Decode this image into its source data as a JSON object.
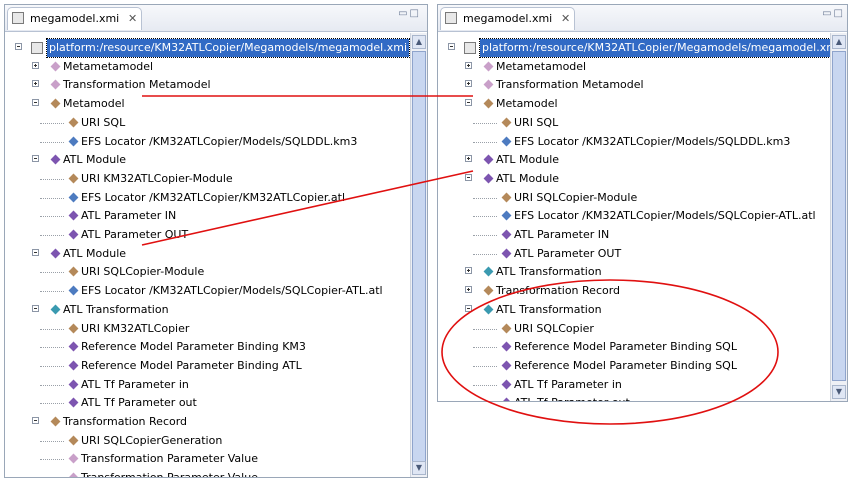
{
  "left": {
    "tab_title": "megamodel.xmi",
    "close_glyph": "✕",
    "rows": [
      {
        "t": "platform:/resource/KM32ATLCopier/Megamodels/megamodel.xmi",
        "lvl": 0,
        "exp": "minus",
        "icon": "xmi",
        "sel": true
      },
      {
        "t": "Metametamodel",
        "lvl": 1,
        "exp": "plus",
        "icon": "light"
      },
      {
        "t": "Transformation Metamodel",
        "lvl": 1,
        "exp": "plus",
        "icon": "light"
      },
      {
        "t": "Metamodel",
        "lvl": 1,
        "exp": "minus",
        "icon": "tan"
      },
      {
        "t": "URI SQL",
        "lvl": 2,
        "icon": "tan"
      },
      {
        "t": "EFS Locator /KM32ATLCopier/Models/SQLDDL.km3",
        "lvl": 2,
        "icon": "blue"
      },
      {
        "t": "ATL Module",
        "lvl": 1,
        "exp": "minus",
        "icon": "purple"
      },
      {
        "t": "URI KM32ATLCopier-Module",
        "lvl": 2,
        "icon": "tan"
      },
      {
        "t": "EFS Locator /KM32ATLCopier/KM32ATLCopier.atl",
        "lvl": 2,
        "icon": "blue"
      },
      {
        "t": "ATL Parameter IN",
        "lvl": 2,
        "icon": "purple"
      },
      {
        "t": "ATL Parameter OUT",
        "lvl": 2,
        "icon": "purple"
      },
      {
        "t": "ATL Module",
        "lvl": 1,
        "exp": "minus",
        "icon": "purple"
      },
      {
        "t": "URI SQLCopier-Module",
        "lvl": 2,
        "icon": "tan"
      },
      {
        "t": "EFS Locator /KM32ATLCopier/Models/SQLCopier-ATL.atl",
        "lvl": 2,
        "icon": "blue"
      },
      {
        "t": "ATL Transformation",
        "lvl": 1,
        "exp": "minus",
        "icon": "teal"
      },
      {
        "t": "URI KM32ATLCopier",
        "lvl": 2,
        "icon": "tan"
      },
      {
        "t": "Reference Model Parameter Binding KM3",
        "lvl": 2,
        "icon": "purple"
      },
      {
        "t": "Reference Model Parameter Binding ATL",
        "lvl": 2,
        "icon": "purple"
      },
      {
        "t": "ATL Tf Parameter in",
        "lvl": 2,
        "icon": "purple"
      },
      {
        "t": "ATL Tf Parameter out",
        "lvl": 2,
        "icon": "purple"
      },
      {
        "t": "Transformation Record",
        "lvl": 1,
        "exp": "minus",
        "icon": "tan"
      },
      {
        "t": "URI SQLCopierGeneration",
        "lvl": 2,
        "icon": "tan"
      },
      {
        "t": "Transformation Parameter Value",
        "lvl": 2,
        "icon": "light"
      },
      {
        "t": "Transformation Parameter Value",
        "lvl": 2,
        "icon": "light"
      }
    ]
  },
  "right": {
    "tab_title": "megamodel.xmi",
    "close_glyph": "✕",
    "rows": [
      {
        "t": "platform:/resource/KM32ATLCopier/Megamodels/megamodel.xmi",
        "lvl": 0,
        "exp": "minus",
        "icon": "xmi",
        "sel": true
      },
      {
        "t": "Metametamodel",
        "lvl": 1,
        "exp": "plus",
        "icon": "light"
      },
      {
        "t": "Transformation Metamodel",
        "lvl": 1,
        "exp": "plus",
        "icon": "light"
      },
      {
        "t": "Metamodel",
        "lvl": 1,
        "exp": "minus",
        "icon": "tan"
      },
      {
        "t": "URI SQL",
        "lvl": 2,
        "icon": "tan"
      },
      {
        "t": "EFS Locator /KM32ATLCopier/Models/SQLDDL.km3",
        "lvl": 2,
        "icon": "blue"
      },
      {
        "t": "ATL Module",
        "lvl": 1,
        "exp": "plus",
        "icon": "purple"
      },
      {
        "t": "ATL Module",
        "lvl": 1,
        "exp": "minus",
        "icon": "purple"
      },
      {
        "t": "URI SQLCopier-Module",
        "lvl": 2,
        "icon": "tan"
      },
      {
        "t": "EFS Locator /KM32ATLCopier/Models/SQLCopier-ATL.atl",
        "lvl": 2,
        "icon": "blue"
      },
      {
        "t": "ATL Parameter IN",
        "lvl": 2,
        "icon": "purple"
      },
      {
        "t": "ATL Parameter OUT",
        "lvl": 2,
        "icon": "purple"
      },
      {
        "t": "ATL Transformation",
        "lvl": 1,
        "exp": "plus",
        "icon": "teal"
      },
      {
        "t": "Transformation Record",
        "lvl": 1,
        "exp": "plus",
        "icon": "tan"
      },
      {
        "t": "ATL Transformation",
        "lvl": 1,
        "exp": "minus",
        "icon": "teal"
      },
      {
        "t": "URI SQLCopier",
        "lvl": 2,
        "icon": "tan"
      },
      {
        "t": "Reference Model Parameter Binding SQL",
        "lvl": 2,
        "icon": "purple"
      },
      {
        "t": "Reference Model Parameter Binding SQL",
        "lvl": 2,
        "icon": "purple"
      },
      {
        "t": "ATL Tf Parameter in",
        "lvl": 2,
        "icon": "purple"
      },
      {
        "t": "ATL Tf Parameter out",
        "lvl": 2,
        "icon": "purple"
      }
    ]
  },
  "colors": {
    "annotation_red": "#e01010",
    "selection_blue": "#316ac5"
  }
}
